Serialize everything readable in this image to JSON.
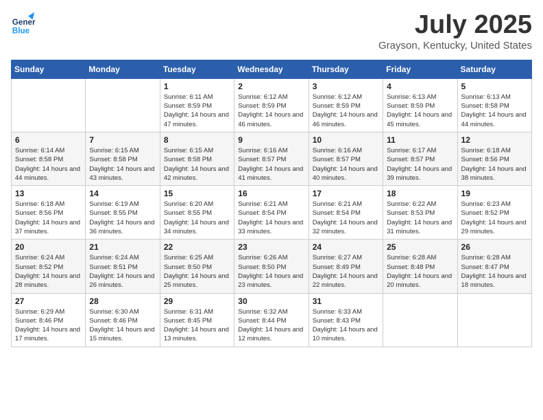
{
  "header": {
    "logo_general": "General",
    "logo_blue": "Blue",
    "month_title": "July 2025",
    "location": "Grayson, Kentucky, United States"
  },
  "days_of_week": [
    "Sunday",
    "Monday",
    "Tuesday",
    "Wednesday",
    "Thursday",
    "Friday",
    "Saturday"
  ],
  "weeks": [
    [
      {
        "day": "",
        "info": ""
      },
      {
        "day": "",
        "info": ""
      },
      {
        "day": "1",
        "info": "Sunrise: 6:11 AM\nSunset: 8:59 PM\nDaylight: 14 hours and 47 minutes."
      },
      {
        "day": "2",
        "info": "Sunrise: 6:12 AM\nSunset: 8:59 PM\nDaylight: 14 hours and 46 minutes."
      },
      {
        "day": "3",
        "info": "Sunrise: 6:12 AM\nSunset: 8:59 PM\nDaylight: 14 hours and 46 minutes."
      },
      {
        "day": "4",
        "info": "Sunrise: 6:13 AM\nSunset: 8:59 PM\nDaylight: 14 hours and 45 minutes."
      },
      {
        "day": "5",
        "info": "Sunrise: 6:13 AM\nSunset: 8:58 PM\nDaylight: 14 hours and 44 minutes."
      }
    ],
    [
      {
        "day": "6",
        "info": "Sunrise: 6:14 AM\nSunset: 8:58 PM\nDaylight: 14 hours and 44 minutes."
      },
      {
        "day": "7",
        "info": "Sunrise: 6:15 AM\nSunset: 8:58 PM\nDaylight: 14 hours and 43 minutes."
      },
      {
        "day": "8",
        "info": "Sunrise: 6:15 AM\nSunset: 8:58 PM\nDaylight: 14 hours and 42 minutes."
      },
      {
        "day": "9",
        "info": "Sunrise: 6:16 AM\nSunset: 8:57 PM\nDaylight: 14 hours and 41 minutes."
      },
      {
        "day": "10",
        "info": "Sunrise: 6:16 AM\nSunset: 8:57 PM\nDaylight: 14 hours and 40 minutes."
      },
      {
        "day": "11",
        "info": "Sunrise: 6:17 AM\nSunset: 8:57 PM\nDaylight: 14 hours and 39 minutes."
      },
      {
        "day": "12",
        "info": "Sunrise: 6:18 AM\nSunset: 8:56 PM\nDaylight: 14 hours and 38 minutes."
      }
    ],
    [
      {
        "day": "13",
        "info": "Sunrise: 6:18 AM\nSunset: 8:56 PM\nDaylight: 14 hours and 37 minutes."
      },
      {
        "day": "14",
        "info": "Sunrise: 6:19 AM\nSunset: 8:55 PM\nDaylight: 14 hours and 36 minutes."
      },
      {
        "day": "15",
        "info": "Sunrise: 6:20 AM\nSunset: 8:55 PM\nDaylight: 14 hours and 34 minutes."
      },
      {
        "day": "16",
        "info": "Sunrise: 6:21 AM\nSunset: 8:54 PM\nDaylight: 14 hours and 33 minutes."
      },
      {
        "day": "17",
        "info": "Sunrise: 6:21 AM\nSunset: 8:54 PM\nDaylight: 14 hours and 32 minutes."
      },
      {
        "day": "18",
        "info": "Sunrise: 6:22 AM\nSunset: 8:53 PM\nDaylight: 14 hours and 31 minutes."
      },
      {
        "day": "19",
        "info": "Sunrise: 6:23 AM\nSunset: 8:52 PM\nDaylight: 14 hours and 29 minutes."
      }
    ],
    [
      {
        "day": "20",
        "info": "Sunrise: 6:24 AM\nSunset: 8:52 PM\nDaylight: 14 hours and 28 minutes."
      },
      {
        "day": "21",
        "info": "Sunrise: 6:24 AM\nSunset: 8:51 PM\nDaylight: 14 hours and 26 minutes."
      },
      {
        "day": "22",
        "info": "Sunrise: 6:25 AM\nSunset: 8:50 PM\nDaylight: 14 hours and 25 minutes."
      },
      {
        "day": "23",
        "info": "Sunrise: 6:26 AM\nSunset: 8:50 PM\nDaylight: 14 hours and 23 minutes."
      },
      {
        "day": "24",
        "info": "Sunrise: 6:27 AM\nSunset: 8:49 PM\nDaylight: 14 hours and 22 minutes."
      },
      {
        "day": "25",
        "info": "Sunrise: 6:28 AM\nSunset: 8:48 PM\nDaylight: 14 hours and 20 minutes."
      },
      {
        "day": "26",
        "info": "Sunrise: 6:28 AM\nSunset: 8:47 PM\nDaylight: 14 hours and 18 minutes."
      }
    ],
    [
      {
        "day": "27",
        "info": "Sunrise: 6:29 AM\nSunset: 8:46 PM\nDaylight: 14 hours and 17 minutes."
      },
      {
        "day": "28",
        "info": "Sunrise: 6:30 AM\nSunset: 8:46 PM\nDaylight: 14 hours and 15 minutes."
      },
      {
        "day": "29",
        "info": "Sunrise: 6:31 AM\nSunset: 8:45 PM\nDaylight: 14 hours and 13 minutes."
      },
      {
        "day": "30",
        "info": "Sunrise: 6:32 AM\nSunset: 8:44 PM\nDaylight: 14 hours and 12 minutes."
      },
      {
        "day": "31",
        "info": "Sunrise: 6:33 AM\nSunset: 8:43 PM\nDaylight: 14 hours and 10 minutes."
      },
      {
        "day": "",
        "info": ""
      },
      {
        "day": "",
        "info": ""
      }
    ]
  ]
}
